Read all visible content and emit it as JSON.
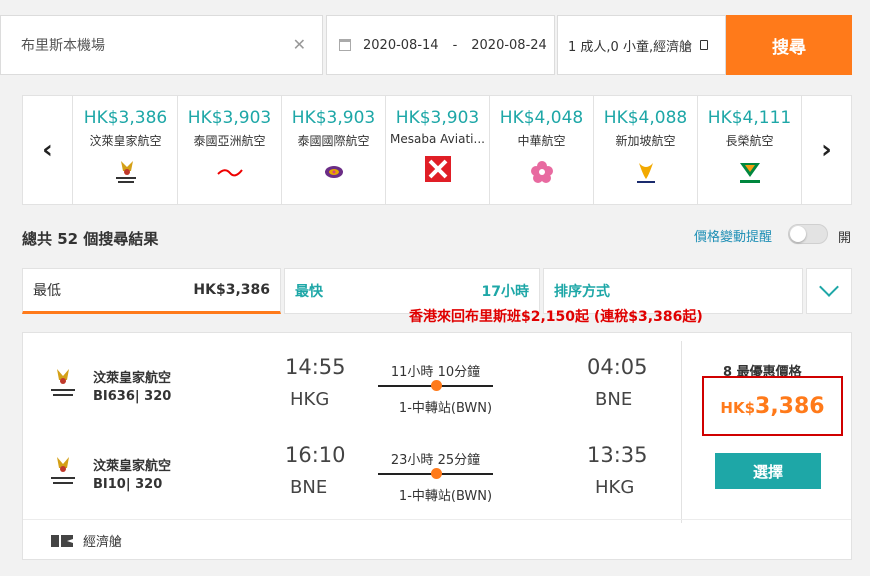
{
  "search": {
    "origin": "布里斯本機場",
    "depart_date": "2020-08-14",
    "date_sep": "-",
    "return_date": "2020-08-24",
    "passengers": "1 成人,0 小童,經濟艙",
    "search_label": "搜尋"
  },
  "airlines": [
    {
      "price": "HK$3,386",
      "name": "汶萊皇家航空",
      "logo": "royal-brunei-logo"
    },
    {
      "price": "HK$3,903",
      "name": "泰國亞洲航空",
      "logo": "thai-airasia-logo"
    },
    {
      "price": "HK$3,903",
      "name": "泰國國際航空",
      "logo": "thai-airways-logo"
    },
    {
      "price": "HK$3,903",
      "name": "Mesaba Aviati...",
      "logo": "mesaba-logo"
    },
    {
      "price": "HK$4,048",
      "name": "中華航空",
      "logo": "china-airlines-logo"
    },
    {
      "price": "HK$4,088",
      "name": "新加坡航空",
      "logo": "singapore-airlines-logo"
    },
    {
      "price": "HK$4,111",
      "name": "長榮航空",
      "logo": "eva-air-logo"
    }
  ],
  "results": {
    "total": "總共 52 個搜尋結果",
    "price_alert": "價格變動提醒",
    "toggle_label": "開"
  },
  "tabs": {
    "cheapest_label": "最低",
    "cheapest_price": "HK$3,386",
    "fastest_label": "最快",
    "fastest_value": "17小時",
    "sort_label": "排序方式"
  },
  "promo": "香港來回布里斯班$2,150起 (連稅$3,386起)",
  "flight": {
    "legs": [
      {
        "airline": "汶萊皇家航空",
        "flight_no": "BI636| 320",
        "dep_time": "14:55",
        "dep_airport": "HKG",
        "duration": "11小時 10分鐘",
        "stops": "1-中轉站(BWN)",
        "arr_time": "04:05",
        "arr_airport": "BNE"
      },
      {
        "airline": "汶萊皇家航空",
        "flight_no": "BI10| 320",
        "dep_time": "16:10",
        "dep_airport": "BNE",
        "duration": "23小時 25分鐘",
        "stops": "1-中轉站(BWN)",
        "arr_time": "13:35",
        "arr_airport": "HKG"
      }
    ],
    "deals": "8 最優惠價格",
    "currency": "HK$",
    "price": "3,386",
    "select_label": "選擇",
    "cabin": "經濟艙"
  },
  "colors": {
    "accent": "#ff7a1a",
    "teal": "#1ea7a7",
    "highlight": "#d00000"
  }
}
